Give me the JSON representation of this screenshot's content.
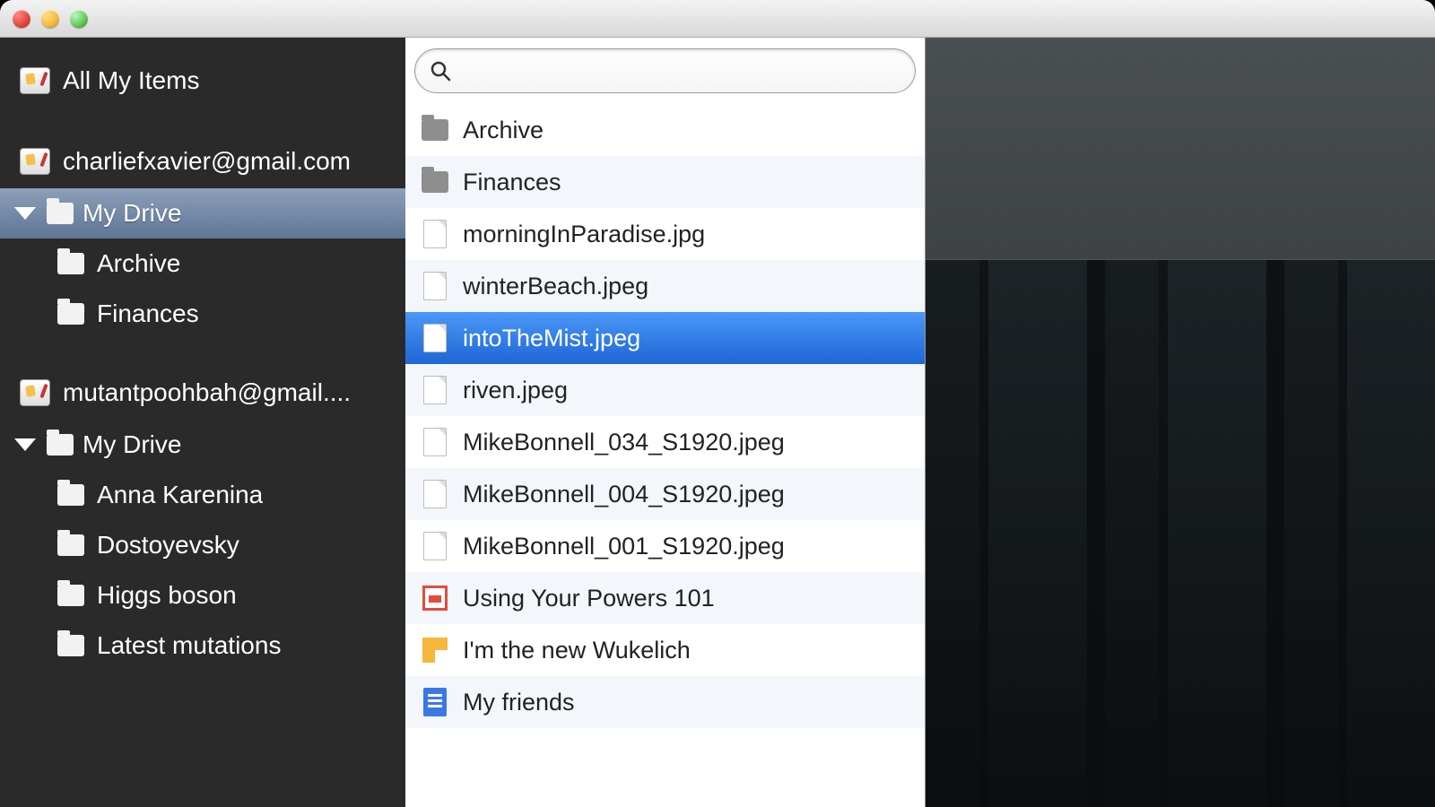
{
  "sidebar": {
    "allItemsLabel": "All My Items",
    "accounts": [
      {
        "email": "charliefxavier@gmail.com",
        "driveLabel": "My Drive",
        "selected": true,
        "folders": [
          "Archive",
          "Finances"
        ]
      },
      {
        "email": "mutantpoohbah@gmail....",
        "driveLabel": "My Drive",
        "selected": false,
        "folders": [
          "Anna Karenina",
          "Dostoyevsky",
          "Higgs boson",
          "Latest mutations"
        ]
      }
    ]
  },
  "search": {
    "placeholder": ""
  },
  "files": [
    {
      "name": "Archive",
      "type": "folder",
      "selected": false
    },
    {
      "name": "Finances",
      "type": "folder",
      "selected": false
    },
    {
      "name": "morningInParadise.jpg",
      "type": "file",
      "selected": false
    },
    {
      "name": "winterBeach.jpeg",
      "type": "file",
      "selected": false
    },
    {
      "name": "intoTheMist.jpeg",
      "type": "file",
      "selected": true
    },
    {
      "name": "riven.jpeg",
      "type": "file",
      "selected": false
    },
    {
      "name": "MikeBonnell_034_S1920.jpeg",
      "type": "file",
      "selected": false
    },
    {
      "name": "MikeBonnell_004_S1920.jpeg",
      "type": "file",
      "selected": false
    },
    {
      "name": "MikeBonnell_001_S1920.jpeg",
      "type": "file",
      "selected": false
    },
    {
      "name": "Using Your Powers 101",
      "type": "slides",
      "selected": false
    },
    {
      "name": "I'm the new Wukelich",
      "type": "drawing",
      "selected": false
    },
    {
      "name": "My friends",
      "type": "gdoc",
      "selected": false
    }
  ]
}
